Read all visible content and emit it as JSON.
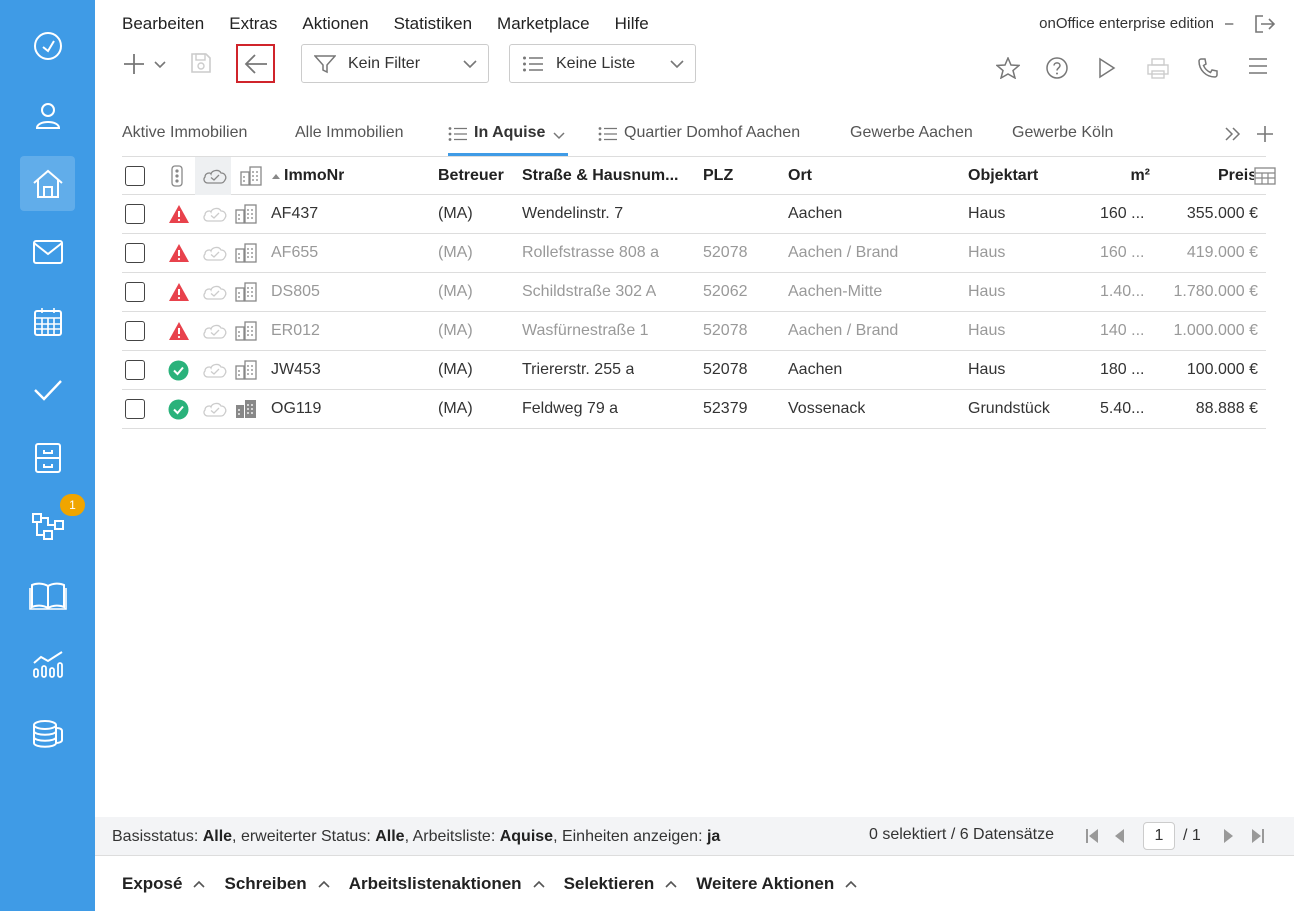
{
  "menu": {
    "items": [
      "Bearbeiten",
      "Extras",
      "Aktionen",
      "Statistiken",
      "Marketplace",
      "Hilfe"
    ],
    "edition": "onOffice enterprise edition",
    "dash": "–"
  },
  "toolbar": {
    "filter_label": "Kein Filter",
    "list_label": "Keine Liste"
  },
  "tabs": [
    {
      "label": "Aktive Immobilien"
    },
    {
      "label": "Alle Immobilien"
    },
    {
      "label": "In Aquise"
    },
    {
      "label": "Quartier Domhof Aachen"
    },
    {
      "label": "Gewerbe Aachen"
    },
    {
      "label": "Gewerbe Köln"
    }
  ],
  "table": {
    "headers": {
      "immonr": "ImmoNr",
      "betreuer": "Betreuer",
      "strasse": "Straße & Hausnum...",
      "plz": "PLZ",
      "ort": "Ort",
      "objektart": "Objektart",
      "m2": "m²",
      "preis": "Preis"
    },
    "rows": [
      {
        "status": "warning",
        "unit_icon": "building-outline",
        "immonr": "AF437",
        "betreuer": "(MA)",
        "strasse": "Wendelinstr. 7",
        "plz": "",
        "ort": "Aachen",
        "objektart": "Haus",
        "m2": "160 ...",
        "preis": "355.000 €",
        "dim": false
      },
      {
        "status": "warning",
        "unit_icon": "building-outline",
        "immonr": "AF655",
        "betreuer": "(MA)",
        "strasse": "Rollefstrasse 808 a",
        "plz": "52078",
        "ort": "Aachen / Brand",
        "objektart": "Haus",
        "m2": "160 ...",
        "preis": "419.000 €",
        "dim": true
      },
      {
        "status": "warning",
        "unit_icon": "building-outline",
        "immonr": "DS805",
        "betreuer": "(MA)",
        "strasse": "Schildstraße 302 A",
        "plz": "52062",
        "ort": "Aachen-Mitte",
        "objektart": "Haus",
        "m2": "1.40...",
        "preis": "1.780.000 €",
        "dim": true
      },
      {
        "status": "warning",
        "unit_icon": "building-outline",
        "immonr": "ER012",
        "betreuer": "(MA)",
        "strasse": "Wasfürnestraße 1",
        "plz": "52078",
        "ort": "Aachen / Brand",
        "objektart": "Haus",
        "m2": "140 ...",
        "preis": "1.000.000 €",
        "dim": true
      },
      {
        "status": "ok",
        "unit_icon": "building-outline",
        "immonr": "JW453",
        "betreuer": "(MA)",
        "strasse": "Triererstr. 255 a",
        "plz": "52078",
        "ort": "Aachen",
        "objektart": "Haus",
        "m2": "180 ...",
        "preis": "100.000 €",
        "dim": false
      },
      {
        "status": "ok",
        "unit_icon": "building-filled",
        "immonr": "OG119",
        "betreuer": "(MA)",
        "strasse": "Feldweg 79 a",
        "plz": "52379",
        "ort": "Vossenack",
        "objektart": "Grundstück",
        "m2": "5.40...",
        "preis": "88.888 €",
        "dim": false
      }
    ]
  },
  "status": {
    "basis_label": "Basisstatus: ",
    "basis_value": "Alle",
    "erw_label": ", erweiterter Status: ",
    "erw_value": "Alle",
    "liste_label": ", Arbeitsliste: ",
    "liste_value": "Aquise",
    "einheiten_label": ", Einheiten anzeigen: ",
    "einheiten_value": "ja",
    "selection": "0 selektiert / 6 Datensätze",
    "page": "1",
    "page_total": "/ 1"
  },
  "actions": [
    "Exposé",
    "Schreiben",
    "Arbeitslistenaktionen",
    "Selektieren",
    "Weitere Aktionen"
  ],
  "sidebar": {
    "icons": [
      "dashboard-icon",
      "user-icon",
      "home-icon",
      "mail-icon",
      "calendar-icon",
      "check-icon",
      "cabinet-icon",
      "process-icon",
      "book-icon",
      "stats-icon",
      "coins-icon"
    ],
    "badge": "1"
  },
  "colors": {
    "sidebar": "#3f9be6",
    "warning": "#e8424c",
    "ok": "#2ab27b",
    "badge": "#f0a500",
    "highlight": "#d0242b"
  }
}
